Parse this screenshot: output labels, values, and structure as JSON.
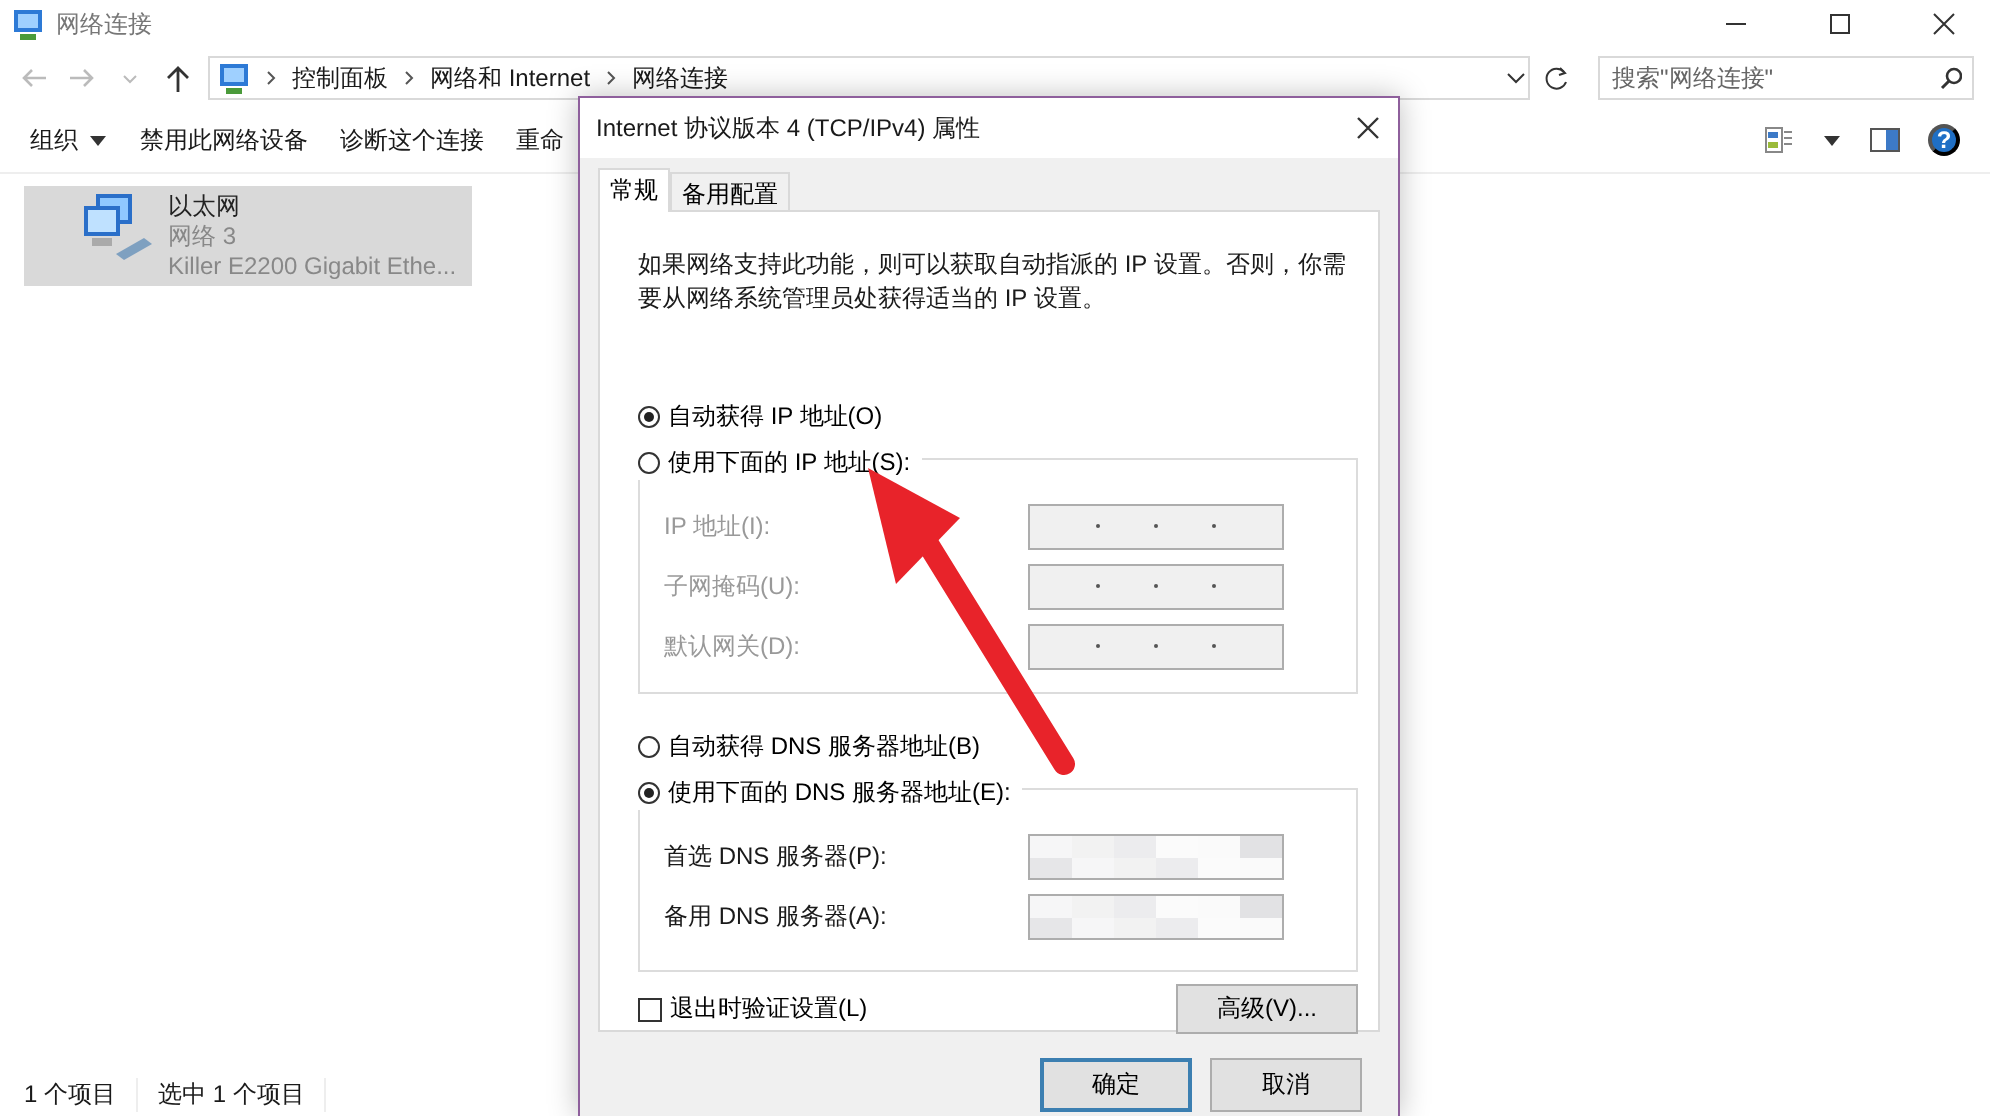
{
  "window": {
    "title": "网络连接"
  },
  "breadcrumb": [
    "控制面板",
    "网络和 Internet",
    "网络连接"
  ],
  "search": {
    "placeholder": "搜索\"网络连接\""
  },
  "help": "?",
  "toolbar": [
    {
      "label": "组织",
      "kind": "menu"
    },
    {
      "label": "禁用此网络设备",
      "kind": "plain"
    },
    {
      "label": "诊断这个连接",
      "kind": "plain"
    },
    {
      "label": "重命",
      "kind": "plain"
    }
  ],
  "items": [
    {
      "name": "以太网",
      "network": "网络 3",
      "adapter": "Killer E2200 Gigabit Ethe...",
      "selected": true
    }
  ],
  "status_bar": [
    "1 个项目",
    "选中 1 个项目"
  ],
  "dialog": {
    "title": "Internet 协议版本 4 (TCP/IPv4) 属性",
    "tabs": [
      {
        "label": "常规",
        "selected": true
      },
      {
        "label": "备用配置",
        "selected": false
      }
    ],
    "description": "如果网络支持此功能，则可以获取自动指派的 IP 设置。否则，你需要从网络系统管理员处获得适当的 IP 设置。",
    "ip_options": [
      {
        "label": "自动获得 IP 地址(O)",
        "selected": true
      },
      {
        "label": "使用下面的 IP 地址(S):",
        "selected": false
      }
    ],
    "ip_fields": [
      {
        "label": "IP 地址(I):",
        "disabled": true
      },
      {
        "label": "子网掩码(U):",
        "disabled": true
      },
      {
        "label": "默认网关(D):",
        "disabled": true
      }
    ],
    "dns_options": [
      {
        "label": "自动获得 DNS 服务器地址(B)",
        "selected": false
      },
      {
        "label": "使用下面的 DNS 服务器地址(E):",
        "selected": true
      }
    ],
    "dns_fields": [
      {
        "label": "首选 DNS 服务器(P):"
      },
      {
        "label": "备用 DNS 服务器(A):"
      }
    ],
    "validate": {
      "label": "退出时验证设置(L)",
      "checked": false
    },
    "advanced": "高级(V)...",
    "buttons": [
      {
        "label": "确定",
        "default": true
      },
      {
        "label": "取消",
        "default": false
      }
    ]
  }
}
